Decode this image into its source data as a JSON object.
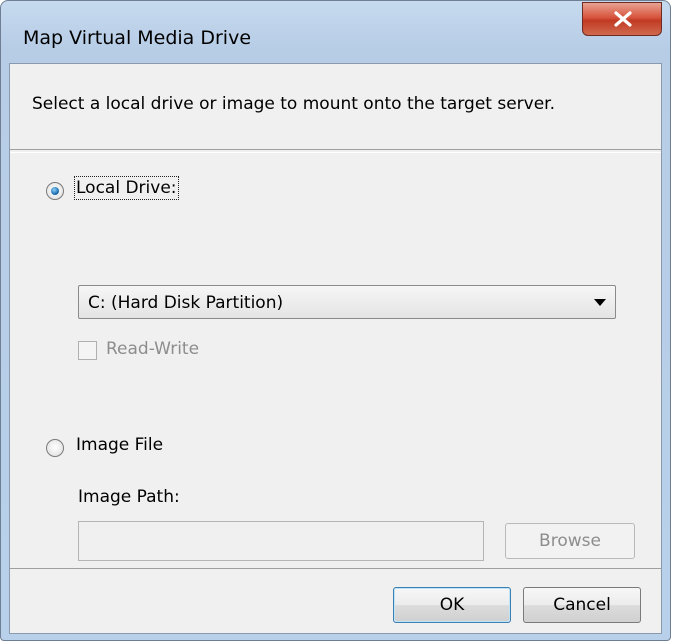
{
  "window": {
    "title": "Map Virtual Media Drive",
    "close_glyph": "X"
  },
  "header": {
    "instruction": "Select a local drive or image to mount onto the target server."
  },
  "local_drive": {
    "label": "Local Drive:",
    "selected": true,
    "dropdown_value": "C: (Hard Disk Partition)",
    "read_write_label": "Read-Write",
    "read_write_checked": false
  },
  "image_file": {
    "label": "Image File",
    "selected": false,
    "path_label": "Image Path:",
    "path_value": "",
    "browse_label": "Browse"
  },
  "footer": {
    "ok_label": "OK",
    "cancel_label": "Cancel"
  },
  "icons": {
    "close": "close-icon",
    "dropdown": "chevron-down-icon"
  }
}
